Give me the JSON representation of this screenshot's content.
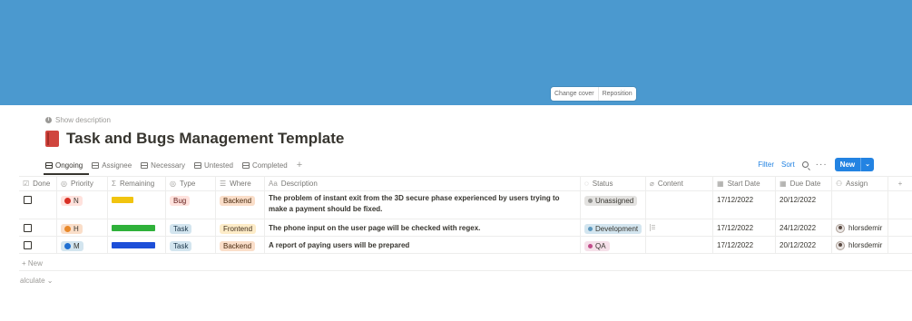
{
  "cover": {
    "color": "#4b99cf",
    "change_label": "Change cover",
    "reposition_label": "Reposition"
  },
  "show_description": "Show description",
  "page": {
    "icon": "red-book-icon",
    "title": "Task and Bugs Management Template"
  },
  "views": [
    {
      "label": "Ongoing",
      "icon": "table-icon",
      "active": true
    },
    {
      "label": "Assignee",
      "icon": "board-icon"
    },
    {
      "label": "Necessary",
      "icon": "table-icon"
    },
    {
      "label": "Untested",
      "icon": "table-icon"
    },
    {
      "label": "Completed",
      "icon": "table-icon"
    }
  ],
  "toolbar": {
    "filter": "Filter",
    "sort": "Sort",
    "new": "New",
    "accent": "#2383e2"
  },
  "columns": {
    "done": "Done",
    "priority": "Priority",
    "remaining": "Remaining",
    "type": "Type",
    "where": "Where",
    "description": "Description",
    "status": "Status",
    "content": "Content",
    "start": "Start Date",
    "due": "Due Date",
    "assign": "Assign"
  },
  "rows": [
    {
      "priority": "N",
      "priority_color": "#d93025",
      "priority_bg": "#ffe2dd",
      "remaining_color": "#f1c40f",
      "remaining_fraction": 0.5,
      "type": "Bug",
      "type_bg": "#ffe2dd",
      "type_fg": "#5d1715",
      "where": "Backend",
      "where_bg": "#fadec9",
      "where_fg": "#49290e",
      "description": "The problem of instant exit from the 3D secure phase experienced by users trying to make a payment should be fixed.",
      "status": "Unassigned",
      "status_bg": "#e3e2e0",
      "status_dot": "#91918e",
      "start": "17/12/2022",
      "due": "20/12/2022",
      "assign": ""
    },
    {
      "priority": "H",
      "priority_color": "#e8892b",
      "priority_bg": "#fadec9",
      "remaining_color": "#2fb13a",
      "remaining_fraction": 1.0,
      "type": "Task",
      "type_bg": "#d3e5ef",
      "type_fg": "#183347",
      "where": "Frontend",
      "where_bg": "#fdecc8",
      "where_fg": "#402c1b",
      "description": "The phone input on the user page will be checked with regex.",
      "status": "Development",
      "status_bg": "#d3e5ef",
      "status_dot": "#5b97bd",
      "start": "17/12/2022",
      "due": "24/12/2022",
      "assign": "hlorsdemir"
    },
    {
      "priority": "M",
      "priority_color": "#1f6fd1",
      "priority_bg": "#d3e5ef",
      "remaining_color": "#1d4fd8",
      "remaining_fraction": 1.0,
      "type": "Task",
      "type_bg": "#d3e5ef",
      "type_fg": "#183347",
      "where": "Backend",
      "where_bg": "#fadec9",
      "where_fg": "#49290e",
      "description": "A report of paying users will be prepared",
      "status": "QA",
      "status_bg": "#f5e0e9",
      "status_dot": "#c14c8a",
      "start": "17/12/2022",
      "due": "20/12/2022",
      "assign": "hlorsdemir"
    }
  ],
  "new_row": "+ New",
  "calculate": "alculate ⌄"
}
